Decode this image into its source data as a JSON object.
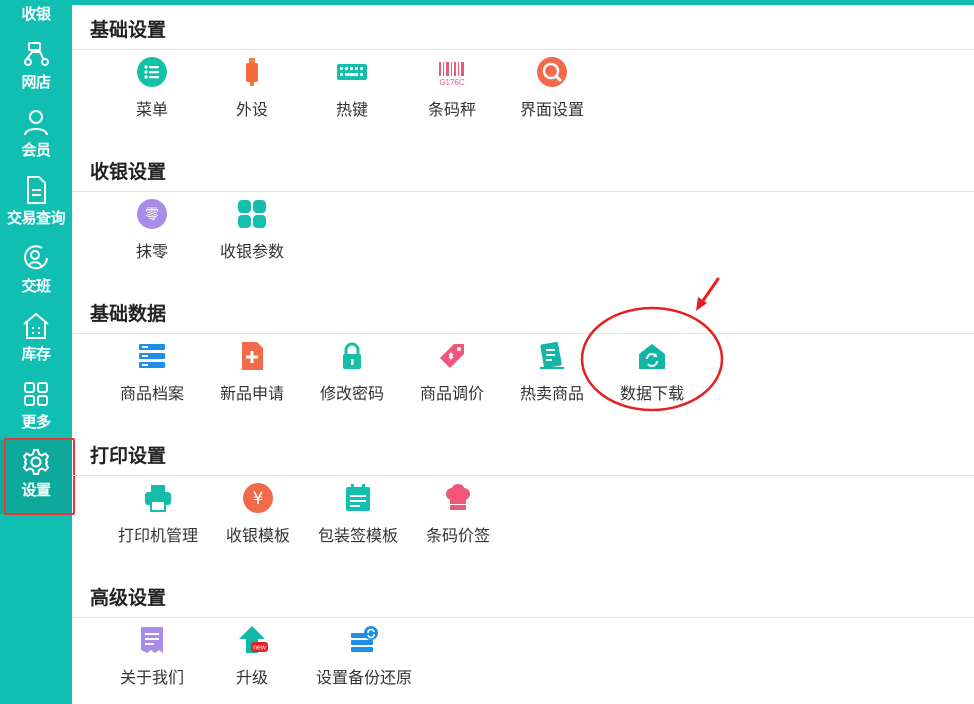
{
  "sidebar": {
    "items": [
      {
        "label": "收银",
        "icon": "cashier-icon"
      },
      {
        "label": "网店",
        "icon": "scooter-icon"
      },
      {
        "label": "会员",
        "icon": "user-icon"
      },
      {
        "label": "交易查询",
        "icon": "document-icon"
      },
      {
        "label": "交班",
        "icon": "shift-icon"
      },
      {
        "label": "库存",
        "icon": "warehouse-icon"
      },
      {
        "label": "更多",
        "icon": "grid-icon"
      },
      {
        "label": "设置",
        "icon": "gear-icon",
        "active": true
      }
    ],
    "background": "#11bfb2"
  },
  "sections": [
    {
      "title": "基础设置",
      "items": [
        {
          "label": "菜单",
          "icon": "menu-list-icon"
        },
        {
          "label": "外设",
          "icon": "usb-device-icon"
        },
        {
          "label": "热键",
          "icon": "keyboard-icon"
        },
        {
          "label": "条码秤",
          "icon": "barcode-icon",
          "icon_text": "G176C"
        },
        {
          "label": "界面设置",
          "icon": "interface-settings-icon"
        }
      ]
    },
    {
      "title": "收银设置",
      "items": [
        {
          "label": "抹零",
          "icon": "round-off-icon",
          "icon_text": "零"
        },
        {
          "label": "收银参数",
          "icon": "four-squares-icon"
        }
      ]
    },
    {
      "title": "基础数据",
      "items": [
        {
          "label": "商品档案",
          "icon": "server-list-icon"
        },
        {
          "label": "新品申请",
          "icon": "new-file-icon"
        },
        {
          "label": "修改密码",
          "icon": "lock-icon"
        },
        {
          "label": "商品调价",
          "icon": "price-tag-icon"
        },
        {
          "label": "热卖商品",
          "icon": "hot-notes-icon"
        },
        {
          "label": "数据下载",
          "icon": "data-download-icon"
        }
      ]
    },
    {
      "title": "打印设置",
      "items": [
        {
          "label": "打印机管理",
          "icon": "printer-icon"
        },
        {
          "label": "收银模板",
          "icon": "yen-icon",
          "icon_text": "¥"
        },
        {
          "label": "包装签模板",
          "icon": "calendar-template-icon"
        },
        {
          "label": "条码价签",
          "icon": "chef-hat-icon"
        }
      ]
    },
    {
      "title": "高级设置",
      "items": [
        {
          "label": "关于我们",
          "icon": "receipt-icon"
        },
        {
          "label": "升级",
          "icon": "upgrade-icon",
          "icon_text": "new"
        },
        {
          "label": "设置备份还原",
          "icon": "backup-restore-icon"
        }
      ]
    }
  ],
  "annotation": {
    "color": "#e62020",
    "target": "数据下载"
  }
}
